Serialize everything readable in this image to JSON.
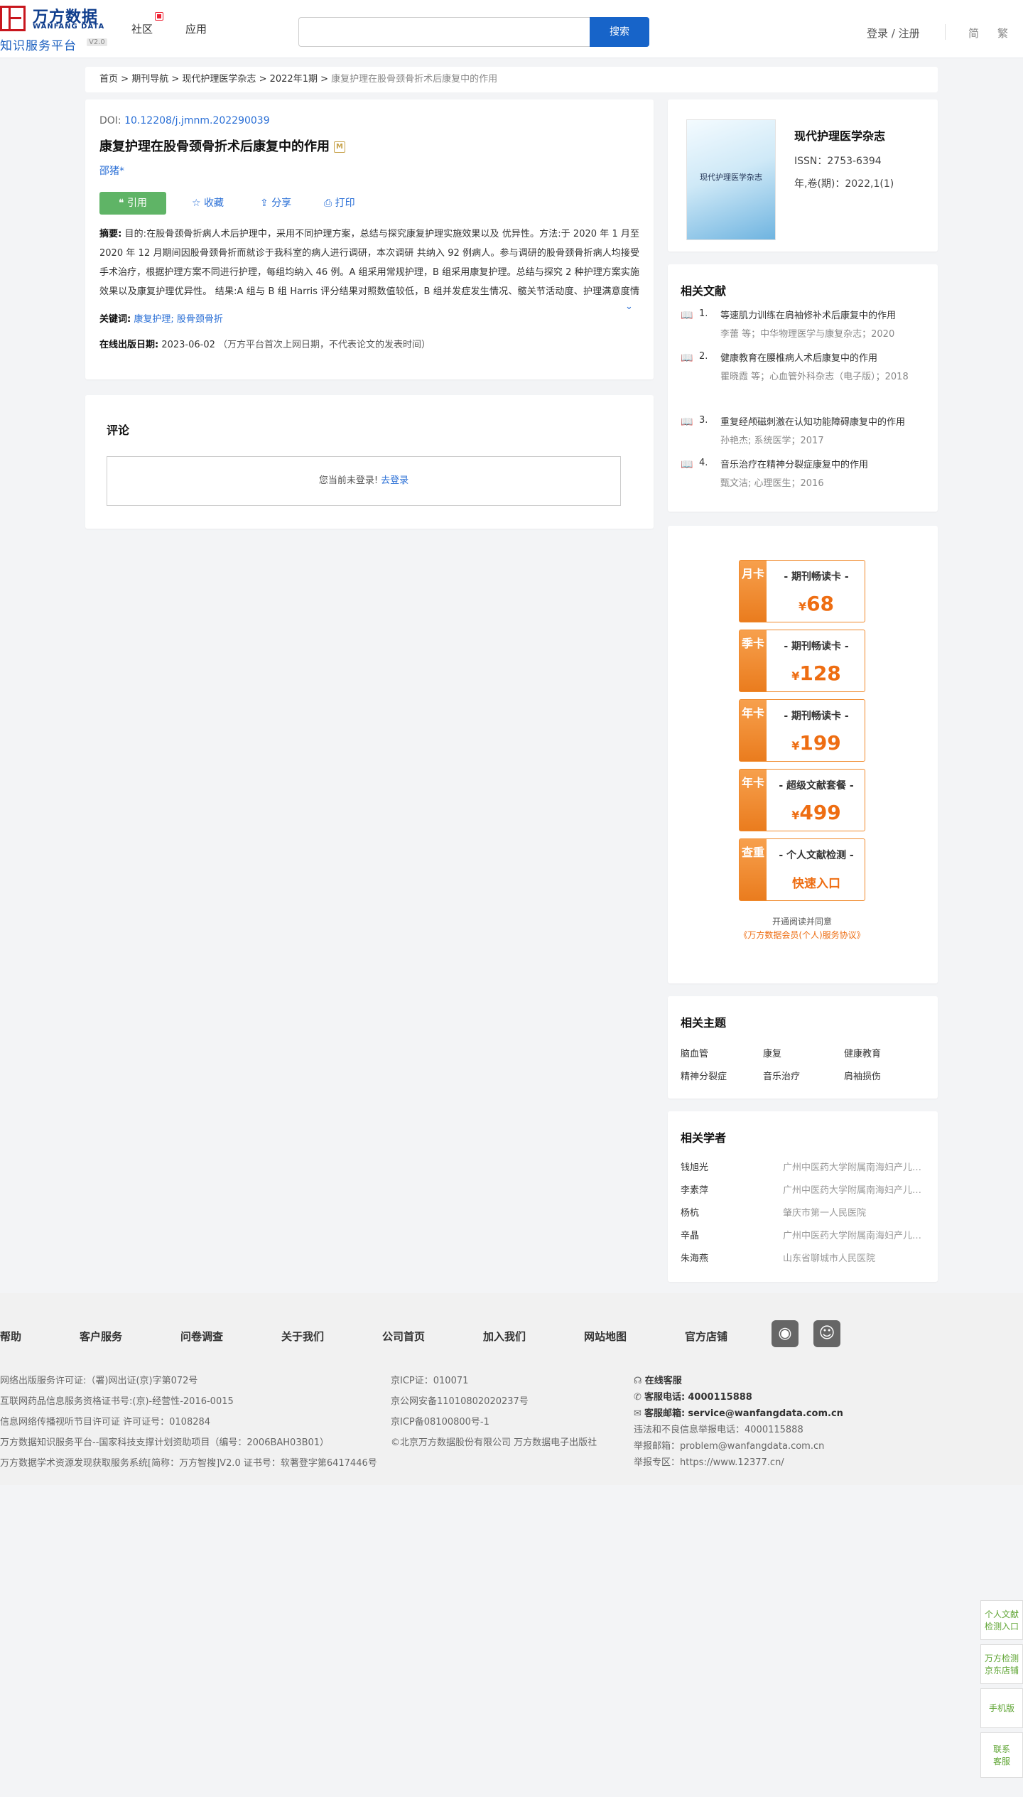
{
  "header": {
    "logo_cn": "万方数据",
    "logo_en": "WANFANG DATA",
    "logo_sub": "知识服务平台",
    "logo_ver": "V2.0",
    "nav": [
      "社区",
      "应用"
    ],
    "search_placeholder": "",
    "search_button": "搜索",
    "login": "登录 / 注册",
    "lang": [
      "简",
      "繁"
    ]
  },
  "breadcrumb": [
    "首页",
    ">",
    "期刊导航",
    ">",
    "现代护理医学杂志",
    ">",
    "2022年1期",
    ">",
    "康复护理在股骨颈骨折术后康复中的作用"
  ],
  "article": {
    "doi_label": "DOI:",
    "doi": "10.12208/j.jmnm.202290039",
    "title": "康复护理在股骨颈骨折术后康复中的作用",
    "title_tag": "M",
    "author": "邵猪*",
    "actions": {
      "cite": "引用",
      "collect": "收藏",
      "share": "分享",
      "print": "打印"
    },
    "abstract_label": "摘要:",
    "abstract": "目的:在股骨颈骨折病人术后护理中，采用不同护理方案，总结与探究康复护理实施效果以及 优异性。方法:于 2020 年 1 月至 2020 年 12 月期间因股骨颈骨折而就诊于我科室的病人进行调研，本次调研 共纳入 92 例病人。参与调研的股骨颈骨折病人均接受手术治疗，根据护理方案不同进行护理，每组均纳入 46 例。A 组采用常规护理，B 组采用康复护理。总结与探究 2 种护理方案实施效果以及康复护理优异性。 结果:A 组与 B 组 Harris 评分结果对照数值较低，B 组并发症发生情况、髋关节活动度、护理满意度情况优 于 A 组，组间差异明显，（P<0.05）。结论:在股骨颈骨折病人术后护理中，康...",
    "keywords_label": "关键词:",
    "keywords": "康复护理; 股骨颈骨折",
    "pub_label": "在线出版日期:",
    "pub_date": "2023-06-02",
    "pub_note": "（万方平台首次上网日期，不代表论文的发表时间）"
  },
  "comment": {
    "title": "评论",
    "not_logged": "您当前未登录!",
    "login_link": "去登录"
  },
  "journal": {
    "name": "现代护理医学杂志",
    "cover_text": "现代护理医学杂志",
    "issn": "ISSN：2753-6394",
    "volume": "年,卷(期)：2022,1(1)"
  },
  "related_docs": {
    "title": "相关文献",
    "items": [
      {
        "num": "1.",
        "title": "等速肌力训练在肩袖修补术后康复中的作用",
        "meta": "李蕾  等；中华物理医学与康复杂志；2020"
      },
      {
        "num": "2.",
        "title": "健康教育在腰椎病人术后康复中的作用",
        "meta": "瞿晓霞  等；心血管外科杂志（电子版）；2018"
      },
      {
        "num": "3.",
        "title": "重复经颅磁刺激在认知功能障碍康复中的作用",
        "meta": "孙艳杰; 系统医学；2017"
      },
      {
        "num": "4.",
        "title": "音乐治疗在精神分裂症康复中的作用",
        "meta": "甄文洁; 心理医生；2016"
      }
    ]
  },
  "vip": {
    "cards": [
      {
        "side": "月卡",
        "name": "- 期刊畅读卡 -",
        "currency": "¥",
        "price": "68"
      },
      {
        "side": "季卡",
        "name": "- 期刊畅读卡 -",
        "currency": "¥",
        "price": "128"
      },
      {
        "side": "年卡",
        "name": "- 期刊畅读卡 -",
        "currency": "¥",
        "price": "199"
      },
      {
        "side": "年卡",
        "name": "- 超级文献套餐 -",
        "currency": "¥",
        "price": "499"
      },
      {
        "side": "查重",
        "name": "- 个人文献检测 -",
        "currency": "",
        "price": "快速入口"
      }
    ],
    "agree_line1": "开通阅读并同意",
    "agree_line2": "《万方数据会员(个人)服务协议》"
  },
  "topics": {
    "title": "相关主题",
    "items": [
      "脑血管",
      "康复",
      "健康教育",
      "精神分裂症",
      "音乐治疗",
      "肩袖损伤"
    ]
  },
  "scholars": {
    "title": "相关学者",
    "items": [
      {
        "name": "钱旭光",
        "org": "广州中医药大学附属南海妇产儿童医院"
      },
      {
        "name": "李素萍",
        "org": "广州中医药大学附属南海妇产儿童医院"
      },
      {
        "name": "杨杭",
        "org": "肇庆市第一人民医院"
      },
      {
        "name": "辛晶",
        "org": "广州中医药大学附属南海妇产儿童医院"
      },
      {
        "name": "朱海燕",
        "org": "山东省聊城市人民医院"
      }
    ]
  },
  "footer": {
    "links": [
      "帮助",
      "客户服务",
      "问卷调查",
      "关于我们",
      "公司首页",
      "加入我们",
      "网站地图",
      "官方店铺"
    ],
    "col1": [
      "网络出版服务许可证:（署)网出证(京)字第072号",
      "互联网药品信息服务资格证书号:(京)-经营性-2016-0015",
      "信息网络传播视听节目许可证 许可证号：0108284",
      "万方数据知识服务平台--国家科技支撑计划资助项目（编号：2006BAH03B01）",
      "万方数据学术资源发现获取服务系统[简称：万方智搜]V2.0 证书号：软著登字第6417446号"
    ],
    "col2": [
      "京ICP证：010071",
      "京公网安备11010802020237号",
      "京ICP备08100800号-1",
      "©北京万方数据股份有限公司 万方数据电子出版社"
    ],
    "service": "在线客服",
    "phone_label": "客服电话:",
    "phone": "4000115888",
    "email_label": "客服邮箱:",
    "email": "service@wanfangdata.com.cn",
    "col3": [
      "违法和不良信息举报电话：4000115888",
      "举报邮箱：problem@wanfangdata.com.cn",
      "举报专区：https://www.12377.cn/"
    ]
  },
  "side_float": [
    {
      "l1": "个人文献",
      "l2": "检测入口"
    },
    {
      "l1": "万方检测",
      "l2": "京东店铺"
    },
    {
      "l1": "手机版",
      "l2": ""
    },
    {
      "l1": "联系",
      "l2": "客服"
    }
  ]
}
